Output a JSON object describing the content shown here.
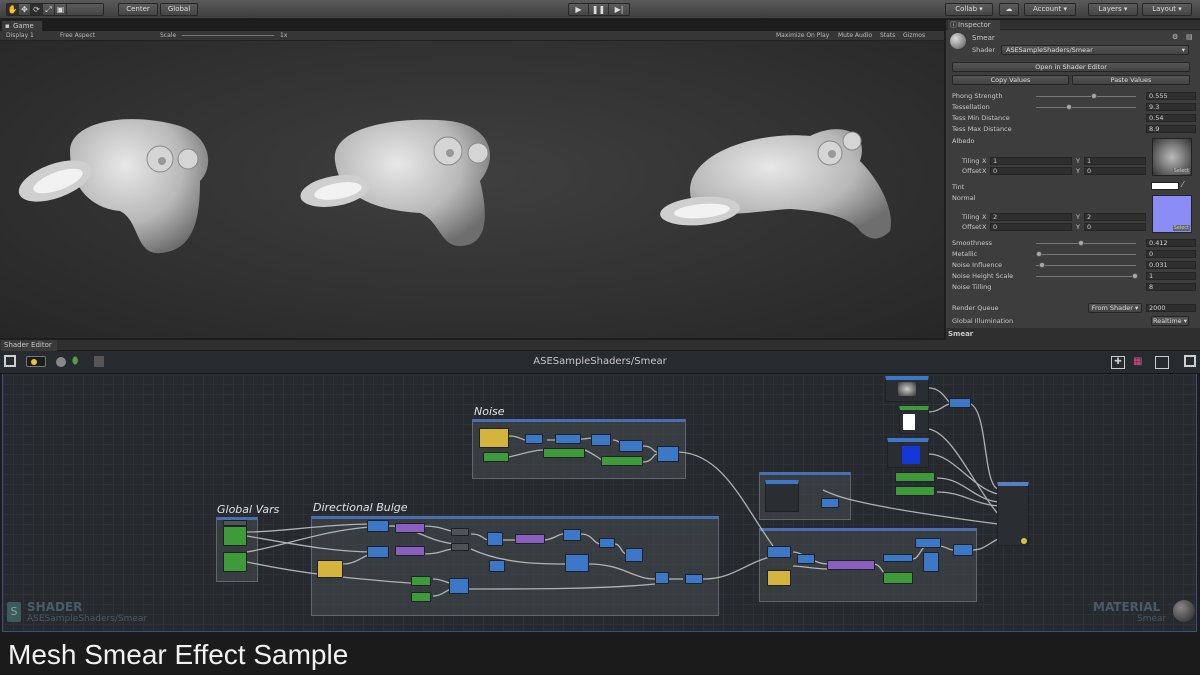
{
  "toolbar": {
    "tool_icons": [
      "hand-icon",
      "move-icon",
      "rotate-icon",
      "scale-icon",
      "rect-icon"
    ],
    "pivot_label": "Center",
    "space_label": "Global",
    "collab_label": "Collab",
    "account_label": "Account",
    "layers_label": "Layers",
    "layout_label": "Layout"
  },
  "game": {
    "tab_label": "Game",
    "display": "Display 1",
    "aspect": "Free Aspect",
    "scale_label": "Scale",
    "scale_value": "1x",
    "options": [
      "Maximize On Play",
      "Mute Audio",
      "Stats",
      "Gizmos"
    ]
  },
  "inspector": {
    "tab_label": "Inspector",
    "material_name": "Smear",
    "shader_label": "Shader",
    "shader_value": "ASESampleShaders/Smear",
    "open_button": "Open in Shader Editor",
    "copy_button": "Copy Values",
    "paste_button": "Paste Values",
    "props": [
      {
        "label": "Phong Strength",
        "value": "0.555",
        "slider": 0.555
      },
      {
        "label": "Tessellation",
        "value": "9.3",
        "slider": 0.32
      },
      {
        "label": "Tess Min Distance",
        "value": "0.54"
      },
      {
        "label": "Tess Max Distance",
        "value": "8.9"
      }
    ],
    "albedo_label": "Albedo",
    "tiling_label": "Tiling",
    "offset_label": "Offset",
    "albedo_tiling_x": "1",
    "albedo_tiling_y": "1",
    "albedo_offset_x": "0",
    "albedo_offset_y": "0",
    "select_label": "Select",
    "tint_label": "Tint",
    "normal_label": "Normal",
    "normal_tiling_x": "2",
    "normal_tiling_y": "2",
    "normal_offset_x": "0",
    "normal_offset_y": "0",
    "props2": [
      {
        "label": "Smoothness",
        "value": "0.412",
        "slider": 0.412
      },
      {
        "label": "Metallic",
        "value": "0",
        "slider": 0
      },
      {
        "label": "Noise Influence",
        "value": "0.031",
        "slider": 0.031
      },
      {
        "label": "Noise Height Scale",
        "value": "1",
        "slider": 1
      },
      {
        "label": "Noise Tilling",
        "value": "8"
      }
    ],
    "render_queue_label": "Render Queue",
    "render_queue_mode": "From Shader",
    "render_queue_value": "2000",
    "gi_label": "Global Illumination",
    "gi_value": "Realtime",
    "footer_label": "Smear",
    "x_label": "X",
    "y_label": "Y"
  },
  "shader_editor": {
    "tab_label": "Shader Editor",
    "title": "ASESampleShaders/Smear",
    "groups": [
      "Noise",
      "Global Vars",
      "Directional Bulge"
    ],
    "shader_caption": "SHADER",
    "shader_path": "ASESampleShaders/Smear",
    "material_caption": "MATERIAL",
    "material_name": "Smear"
  },
  "caption": "Mesh Smear Effect Sample",
  "colors": {
    "accent": "#4a6fb0",
    "node_green": "#3f9b3a",
    "node_yellow": "#d4b43c",
    "node_purple": "#8a5fc0",
    "node_blue": "#3d78c8"
  }
}
